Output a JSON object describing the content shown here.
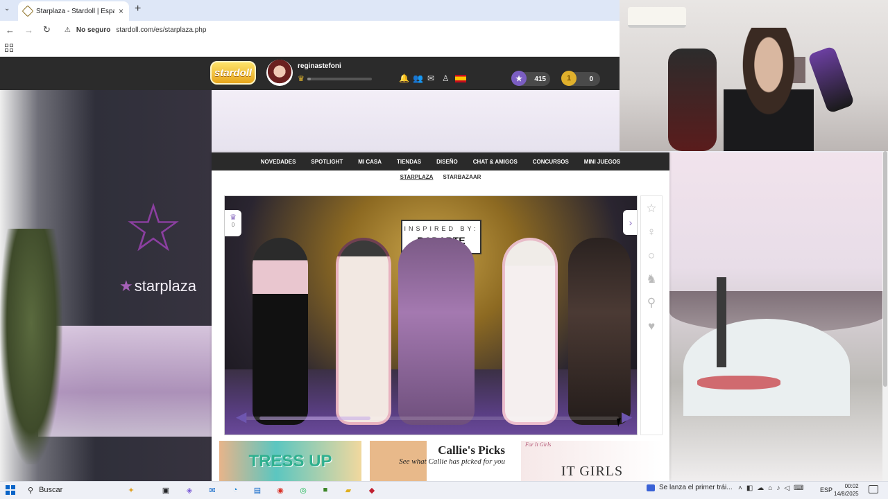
{
  "browser": {
    "tab_title": "Starplaza - Stardoll | Español",
    "tab_close": "×",
    "new_tab": "+",
    "tab_menu": "⌄",
    "security": "No seguro",
    "url": "stardoll.com/es/starplaza.php"
  },
  "stardoll": {
    "logo_text": "stardoll",
    "username": "reginastefoni",
    "level_progress": 0.05,
    "stardollars_value": "415",
    "coins_value": "0",
    "colors": {
      "accent": "#7b5ec2",
      "nav_bg": "#2a2a2a",
      "header_bg": "#2b2b2b"
    }
  },
  "background": {
    "starplaza_sign": "starplaza"
  },
  "nav": {
    "items": [
      {
        "label": "NOVEDADES"
      },
      {
        "label": "SPOTLIGHT"
      },
      {
        "label": "MI CASA"
      },
      {
        "label": "TIENDAS"
      },
      {
        "label": "DISEÑO"
      },
      {
        "label": "CHAT & AMIGOS"
      },
      {
        "label": "CONCURSOS"
      },
      {
        "label": "MINI JUEGOS"
      }
    ],
    "active": "TIENDAS",
    "sub": [
      {
        "label": "STARPLAZA"
      },
      {
        "label": "STARBAZAAR"
      }
    ]
  },
  "showcase": {
    "inspired_kicker": "INSPIRED BY:",
    "inspired_name": "RODARTE",
    "crown_count": "0"
  },
  "promos": [
    {
      "title": "TRESS UP"
    },
    {
      "title": "Callie's Picks",
      "subtitle": "See what Callie has picked for you"
    },
    {
      "title": "IT GIRLS",
      "kicker": "For It Girls"
    }
  ],
  "taskbar": {
    "search_placeholder": "Buscar",
    "news": "Se lanza el primer trái...",
    "lang": "ESP",
    "time": "00:02",
    "date": "14/8/2025"
  }
}
